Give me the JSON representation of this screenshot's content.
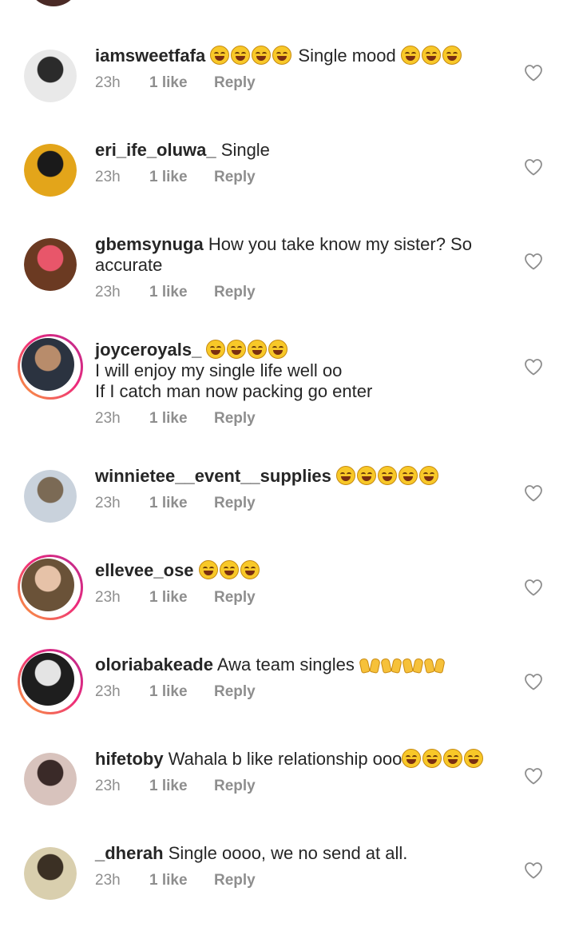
{
  "comments": [
    {
      "username": "iamsweetfafa",
      "emoji_before": 4,
      "text": " Single mood ",
      "emoji_after": 3,
      "time": "23h",
      "likes": "1 like",
      "reply": "Reply",
      "avatar_ring": false,
      "avatar_colors": [
        "#e9e9e9",
        "#2b2b2b"
      ]
    },
    {
      "username": "eri_ife_oluwa_",
      "text": " Single",
      "time": "23h",
      "likes": "1 like",
      "reply": "Reply",
      "avatar_ring": false,
      "avatar_colors": [
        "#e3a51a",
        "#1a1a1a"
      ]
    },
    {
      "username": "gbemsynuga",
      "text": " How you take know my sister? So accurate",
      "time": "23h",
      "likes": "1 like",
      "reply": "Reply",
      "avatar_ring": false,
      "avatar_colors": [
        "#6b3a22",
        "#e8566a"
      ]
    },
    {
      "username": "joyceroyals_",
      "emoji_before": 4,
      "text_lines": [
        "I will enjoy my single life well oo",
        "If I catch man now packing go enter"
      ],
      "time": "23h",
      "likes": "1 like",
      "reply": "Reply",
      "avatar_ring": true,
      "avatar_colors": [
        "#2b3340",
        "#b88c6b"
      ]
    },
    {
      "username": "winnietee__event__supplies",
      "emoji_before": 5,
      "time": "23h",
      "likes": "1 like",
      "reply": "Reply",
      "avatar_ring": false,
      "avatar_colors": [
        "#c9d2dc",
        "#7b6a55"
      ]
    },
    {
      "username": "ellevee_ose",
      "emoji_before": 3,
      "time": "23h",
      "likes": "1 like",
      "reply": "Reply",
      "avatar_ring": true,
      "avatar_colors": [
        "#6a5238",
        "#e6c2a8"
      ]
    },
    {
      "username": "oloriabakeade",
      "text": " Awa team singles ",
      "hands_after": 4,
      "time": "23h",
      "likes": "1 like",
      "reply": "Reply",
      "avatar_ring": true,
      "avatar_colors": [
        "#1e1e1e",
        "#e4e4e4"
      ]
    },
    {
      "username": "hifetoby",
      "text": " Wahala b like relationship ooo",
      "emoji_after": 4,
      "time": "23h",
      "likes": "1 like",
      "reply": "Reply",
      "avatar_ring": false,
      "avatar_colors": [
        "#d8c3bd",
        "#3a2a28"
      ]
    },
    {
      "username": "_dherah",
      "text": " Single oooo, we no send at all.",
      "time": "23h",
      "likes": "1 like",
      "reply": "Reply",
      "avatar_ring": false,
      "avatar_colors": [
        "#d9cfae",
        "#3b3024"
      ]
    }
  ],
  "icons": {
    "like": "heart-outline-icon",
    "laughing_emoji": "face-with-tears-of-joy",
    "raised_hands_emoji": "raising-hands"
  },
  "colors": {
    "text": "#262626",
    "meta": "#8e8e8e",
    "story_ring_start": "#f9a23a",
    "story_ring_end": "#b72b8f"
  }
}
